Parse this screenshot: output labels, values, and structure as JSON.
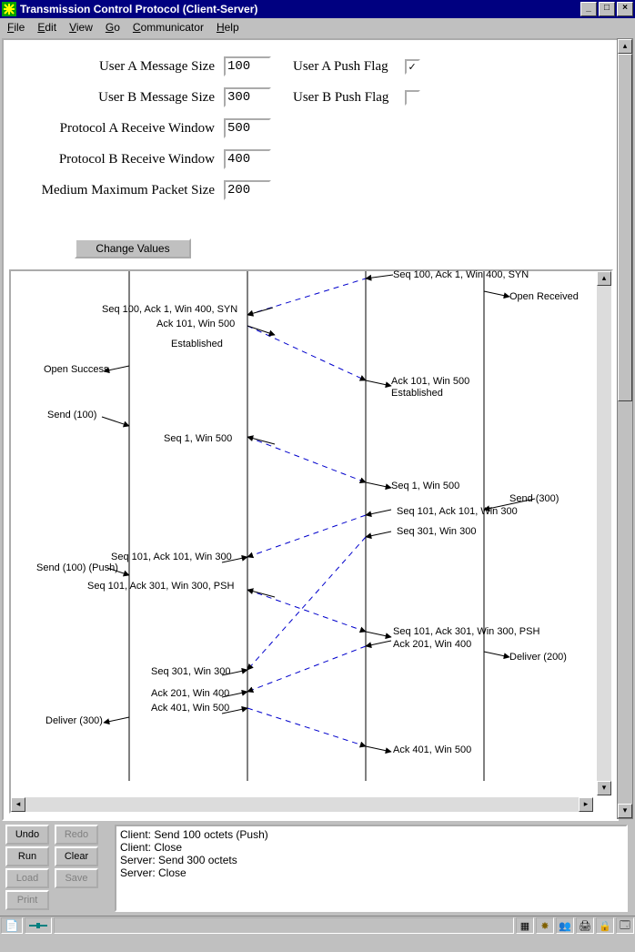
{
  "window": {
    "title": "Transmission Control Protocol (Client-Server)"
  },
  "menu": {
    "file": "File",
    "edit": "Edit",
    "view": "View",
    "go": "Go",
    "communicator": "Communicator",
    "help": "Help"
  },
  "params": {
    "userA_size_label": "User A Message Size",
    "userA_size_value": "100",
    "userA_push_label": "User A Push Flag",
    "userA_push_checked": "✓",
    "userB_size_label": "User B Message Size",
    "userB_size_value": "300",
    "userB_push_label": "User B Push Flag",
    "userB_push_checked": "",
    "protA_label": "Protocol A Receive Window",
    "protA_value": "500",
    "protB_label": "Protocol B Receive Window",
    "protB_value": "400",
    "medium_label": "Medium Maximum Packet Size",
    "medium_value": "200",
    "change_btn": "Change Values"
  },
  "diagram": {
    "labels": {
      "l1": "Seq 100, Ack 1, Win 400, SYN",
      "l2": "Open Received",
      "l3": "Seq 100, Ack 1, Win 400, SYN",
      "l4": "Ack 101, Win 500",
      "l5": "Established",
      "l6": "Open Success",
      "l7": "Ack 101, Win 500",
      "l8": "Established",
      "l9": "Send (100)",
      "l10": "Seq 1, Win 500",
      "l11": "Seq 1, Win 500",
      "l12": "Send (300)",
      "l13": "Seq 101, Ack 101, Win 300",
      "l14": "Seq 301, Win 300",
      "l15": "Seq 101, Ack 101, Win 300",
      "l16": "Send (100) (Push)",
      "l17": "Seq 101, Ack 301, Win 300, PSH",
      "l18": "Seq 101, Ack 301, Win 300, PSH",
      "l19": "Ack 201, Win 400",
      "l20": "Deliver (200)",
      "l21": "Seq 301, Win 300",
      "l22": "Ack 201, Win 400",
      "l23": "Ack 401, Win 500",
      "l24": "Deliver (300)",
      "l25": "Ack 401, Win 500"
    }
  },
  "buttons": {
    "undo": "Undo",
    "redo": "Redo",
    "run": "Run",
    "clear": "Clear",
    "load": "Load",
    "save": "Save",
    "print": "Print"
  },
  "log": "Client: Send 100 octets (Push)\nClient: Close\nServer: Send 300 octets\nServer: Close"
}
